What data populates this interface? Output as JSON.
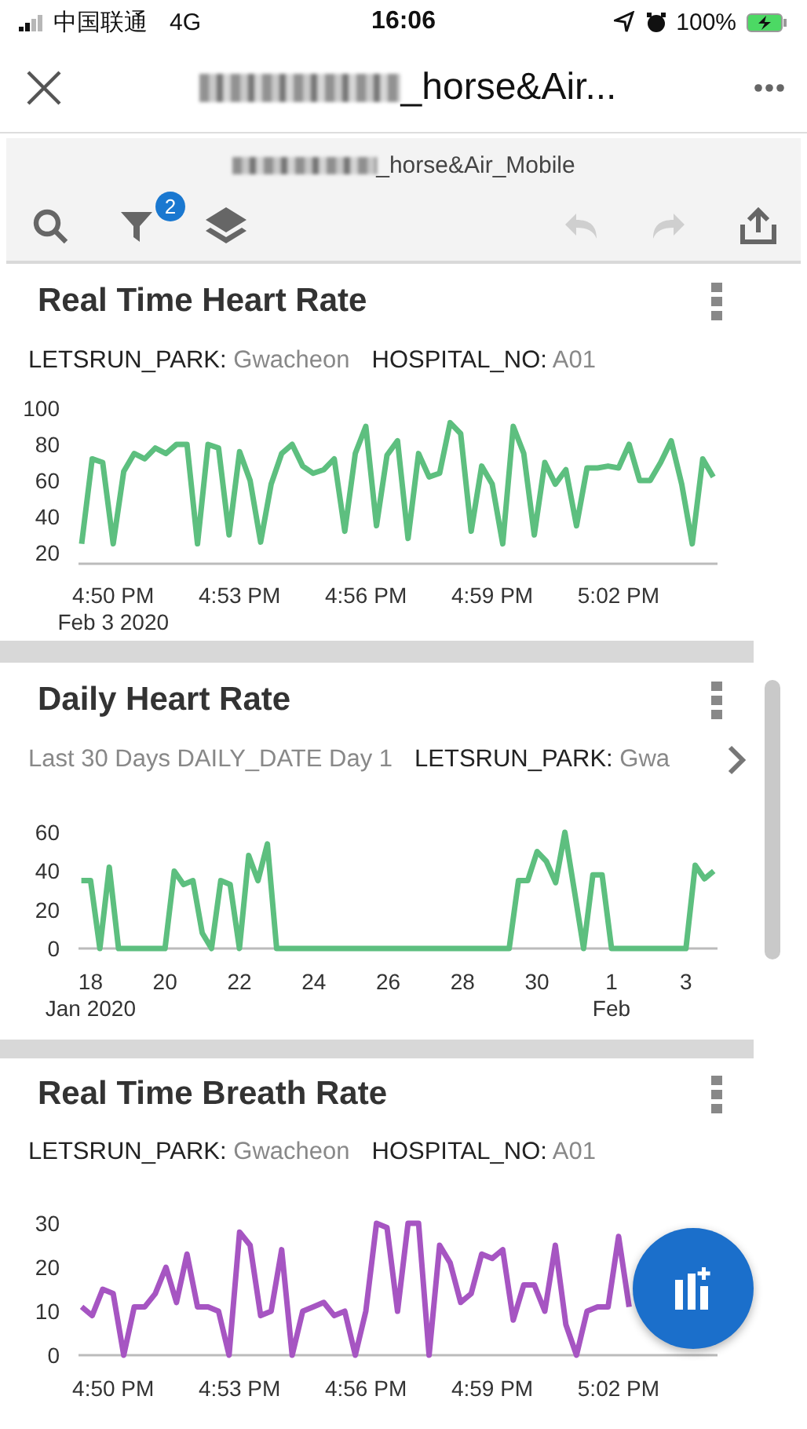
{
  "status_bar": {
    "carrier": "中国联通",
    "network": "4G",
    "time": "16:06",
    "battery": "100%"
  },
  "nav": {
    "title": "_horse&Air..."
  },
  "dashboard": {
    "subtitle": "_horse&Air_Mobile",
    "filter_count": "2",
    "undo": {
      "disabled": true
    },
    "redo": {
      "disabled": true
    }
  },
  "cards": [
    {
      "title": "Real Time Heart Rate",
      "filters": [
        {
          "key": "LETSRUN_PARK:",
          "value": "Gwacheon"
        },
        {
          "key": "HOSPITAL_NO:",
          "value": "A01"
        }
      ],
      "more_filters": false,
      "chart_data": {
        "type": "line",
        "ylim": [
          14,
          100
        ],
        "yticks": [
          20,
          40,
          60,
          80,
          100
        ],
        "categories": [
          null,
          null,
          null,
          "4:50 PM\nFeb 3 2020",
          null,
          null,
          null,
          null,
          null,
          null,
          null,
          null,
          null,
          null,
          null,
          "4:53 PM",
          null,
          null,
          null,
          null,
          null,
          null,
          null,
          null,
          null,
          null,
          null,
          "4:56 PM",
          null,
          null,
          null,
          null,
          null,
          null,
          null,
          null,
          null,
          null,
          null,
          "4:59 PM",
          null,
          null,
          null,
          null,
          null,
          null,
          null,
          null,
          null,
          null,
          null,
          "5:02 PM",
          null,
          null,
          null,
          null,
          null,
          null,
          null,
          null,
          null
        ],
        "series": [
          {
            "color": "#5dbf7f",
            "values": [
              25,
              72,
              70,
              25,
              65,
              75,
              72,
              78,
              75,
              80,
              80,
              25,
              80,
              78,
              30,
              76,
              60,
              26,
              58,
              75,
              80,
              68,
              64,
              66,
              72,
              32,
              75,
              90,
              35,
              74,
              82,
              28,
              75,
              62,
              64,
              92,
              86,
              32,
              68,
              58,
              25,
              90,
              75,
              30,
              70,
              58,
              66,
              35,
              67,
              67,
              68,
              67,
              80,
              60,
              60,
              70,
              82,
              58,
              25,
              72,
              62
            ]
          }
        ]
      }
    },
    {
      "title": "Daily Heart Rate",
      "filters": [
        {
          "value": "Last 30 Days DAILY_DATE Day 1"
        },
        {
          "key": "LETSRUN_PARK:",
          "value": "Gwa"
        }
      ],
      "more_filters": true,
      "chart_data": {
        "type": "line",
        "ylim": [
          0,
          60
        ],
        "yticks": [
          0,
          20,
          40,
          60
        ],
        "categories": [
          null,
          "18\nJan 2020",
          null,
          null,
          null,
          null,
          null,
          null,
          null,
          "20",
          null,
          null,
          null,
          null,
          null,
          null,
          null,
          "22",
          null,
          null,
          null,
          null,
          null,
          null,
          null,
          "24",
          null,
          null,
          null,
          null,
          null,
          null,
          null,
          "26",
          null,
          null,
          null,
          null,
          null,
          null,
          null,
          "28",
          null,
          null,
          null,
          null,
          null,
          null,
          null,
          "30",
          null,
          null,
          null,
          null,
          null,
          null,
          null,
          "1\nFeb",
          null,
          null,
          null,
          null,
          null,
          null,
          null,
          "3",
          null,
          null,
          null
        ],
        "series": [
          {
            "color": "#5dbf7f",
            "values": [
              35,
              35,
              0,
              42,
              0,
              0,
              0,
              0,
              0,
              0,
              40,
              33,
              35,
              8,
              0,
              35,
              33,
              0,
              48,
              35,
              54,
              0,
              0,
              0,
              0,
              0,
              0,
              0,
              0,
              0,
              0,
              0,
              0,
              0,
              0,
              0,
              0,
              0,
              0,
              0,
              0,
              0,
              0,
              0,
              0,
              0,
              0,
              35,
              35,
              50,
              45,
              34,
              60,
              30,
              0,
              38,
              38,
              0,
              0,
              0,
              0,
              0,
              0,
              0,
              0,
              0,
              43,
              36,
              40
            ]
          }
        ]
      }
    },
    {
      "title": "Real Time Breath Rate",
      "filters": [
        {
          "key": "LETSRUN_PARK:",
          "value": "Gwacheon"
        },
        {
          "key": "HOSPITAL_NO:",
          "value": "A01"
        }
      ],
      "more_filters": false,
      "chart_data": {
        "type": "line",
        "ylim": [
          0,
          30
        ],
        "yticks": [
          0,
          10,
          20,
          30
        ],
        "categories": [
          null,
          null,
          null,
          "4:50 PM",
          null,
          null,
          null,
          null,
          null,
          null,
          null,
          null,
          null,
          null,
          null,
          "4:53 PM",
          null,
          null,
          null,
          null,
          null,
          null,
          null,
          null,
          null,
          null,
          null,
          "4:56 PM",
          null,
          null,
          null,
          null,
          null,
          null,
          null,
          null,
          null,
          null,
          null,
          "4:59 PM",
          null,
          null,
          null,
          null,
          null,
          null,
          null,
          null,
          null,
          null,
          null,
          "5:02 PM",
          null,
          null,
          null,
          null,
          null,
          null,
          null,
          null,
          null
        ],
        "series": [
          {
            "color": "#a655c2",
            "values": [
              11,
              9,
              15,
              14,
              0,
              11,
              11,
              14,
              20,
              12,
              23,
              11,
              11,
              10,
              0,
              28,
              25,
              9,
              10,
              24,
              0,
              10,
              11,
              12,
              9,
              10,
              0,
              10,
              30,
              29,
              10,
              30,
              30,
              0,
              25,
              21,
              12,
              14,
              23,
              22,
              24,
              8,
              16,
              16,
              10,
              25,
              7,
              0,
              10,
              11,
              11,
              27,
              11,
              null,
              null,
              null,
              null,
              null,
              null,
              null,
              null
            ]
          }
        ]
      }
    }
  ]
}
